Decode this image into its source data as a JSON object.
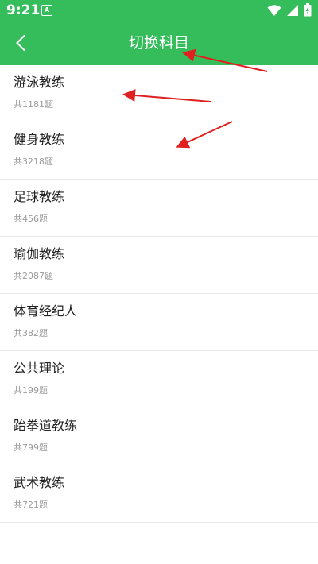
{
  "status_bar": {
    "time": "9:21",
    "notification_icon": "A",
    "icons": [
      "wifi-icon",
      "signal-icon",
      "battery-charging-icon"
    ]
  },
  "app_bar": {
    "back_icon": "chevron-left-icon",
    "title": "切换科目"
  },
  "subjects": [
    {
      "name": "游泳教练",
      "count": "共1181题"
    },
    {
      "name": "健身教练",
      "count": "共3218题"
    },
    {
      "name": "足球教练",
      "count": "共456题"
    },
    {
      "name": "瑜伽教练",
      "count": "共2087题"
    },
    {
      "name": "体育经纪人",
      "count": "共382题"
    },
    {
      "name": "公共理论",
      "count": "共199题"
    },
    {
      "name": "跆拳道教练",
      "count": "共799题"
    },
    {
      "name": "武术教练",
      "count": "共721题"
    }
  ],
  "colors": {
    "primary": "#35bd5c",
    "title_text": "#222222",
    "count_text": "#9a9a9a",
    "divider": "#e9e9e9",
    "annotation_arrow": "#e02020"
  }
}
